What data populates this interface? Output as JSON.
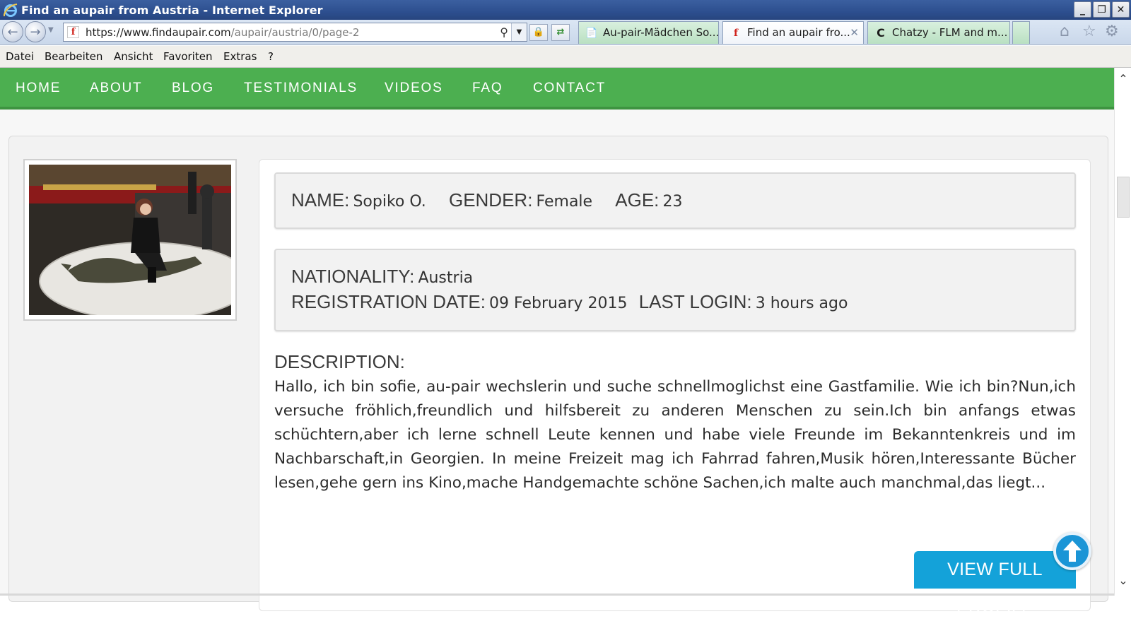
{
  "window": {
    "title": "Find an aupair from Austria - Internet Explorer",
    "controls": [
      "_",
      "❐",
      "✕"
    ]
  },
  "browser": {
    "url_host": "https://www.findaupair.com",
    "url_path": "/aupair/austria/0/page-2",
    "tabs": [
      {
        "label": "Au-pair-Mädchen So...",
        "icon": "document-icon"
      },
      {
        "label": "Find an aupair fro...",
        "icon": "findaupair-favicon",
        "close": "✕"
      },
      {
        "label": "Chatzy - FLM and m...",
        "icon": "chatzy-favicon"
      }
    ]
  },
  "menu": [
    "Datei",
    "Bearbeiten",
    "Ansicht",
    "Favoriten",
    "Extras",
    "?"
  ],
  "site_nav": [
    "HOME",
    "ABOUT",
    "BLOG",
    "TESTIMONIALS",
    "VIDEOS",
    "FAQ",
    "CONTACT"
  ],
  "profile": {
    "name_label": "NAME:",
    "name": "Sopiko O.",
    "gender_label": "GENDER:",
    "gender": "Female",
    "age_label": "AGE:",
    "age": "23",
    "nationality_label": "NATIONALITY:",
    "nationality": "Austria",
    "registration_label": "REGISTRATION DATE:",
    "registration_date": "09 February 2015",
    "last_login_label": "LAST LOGIN:",
    "last_login": "3 hours ago",
    "description_label": "DESCRIPTION:",
    "description": "Hallo, ich bin sofie, au-pair wechslerin und suche schnellmoglichst eine Gastfamilie. Wie ich bin?Nun,ich versuche fröhlich,freundlich und hilfsbereit zu anderen Menschen zu sein.Ich bin anfangs etwas schüchtern,aber ich lerne schnell Leute kennen und habe viele Freunde im Bekanntenkreis und im Nachbarschaft,in Georgien. In meine Freizeit mag ich Fahrrad fahren,Musik hören,Interessante Bücher lesen,gehe gern ins Kino,mache Handgemachte schöne Sachen,ich malte auch manchmal,das liegt...",
    "view_button": "VIEW FULL PROFILE"
  },
  "colors": {
    "nav_green": "#4caf50",
    "button_blue": "#14a2d9"
  }
}
